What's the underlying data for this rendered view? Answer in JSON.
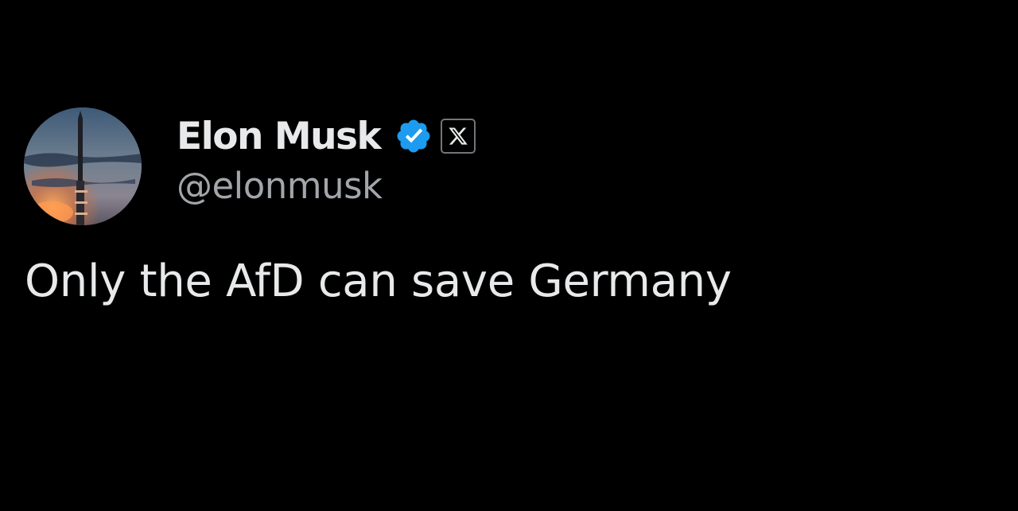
{
  "tweet": {
    "author": {
      "display_name": "Elon Musk",
      "handle": "@elonmusk",
      "avatar_icon": "rocket-launch-avatar",
      "verified_icon": "verified-badge-icon",
      "affiliate_icon": "x-logo-icon"
    },
    "text": "Only the AfD can save Germany"
  },
  "colors": {
    "background": "#000000",
    "primary_text": "#e7e9ea",
    "secondary_text": "#a2a6aa",
    "verified_blue": "#1d9bf0"
  }
}
